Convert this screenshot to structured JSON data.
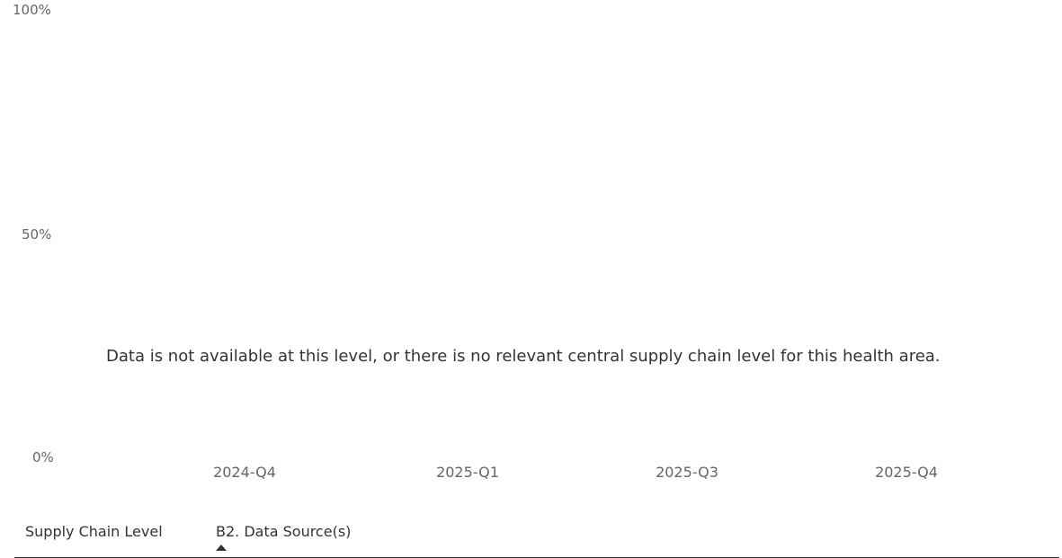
{
  "chart_data": {
    "type": "bar",
    "categories": [
      "2024-Q4",
      "2025-Q1",
      "2025-Q3",
      "2025-Q4"
    ],
    "series": [],
    "y_ticks": [
      "100%",
      "50%",
      "0%"
    ],
    "ylim": [
      0,
      100
    ],
    "message": "Data is not available at this level, or there is no relevant central supply chain level for this health area.",
    "grid": false
  },
  "table": {
    "columns": [
      "Supply Chain Level",
      "B2. Data Source(s)"
    ],
    "sorted_column_index": 1,
    "sort_direction": "ascending"
  }
}
